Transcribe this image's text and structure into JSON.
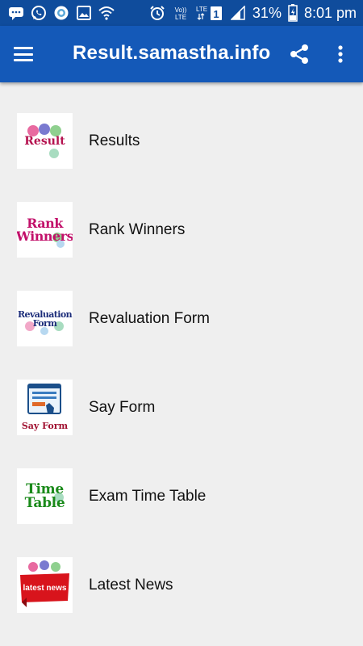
{
  "status_bar": {
    "battery": "31%",
    "time": "8:01 pm",
    "volte_label": "Vo)\nLTE",
    "lte_label": "LTE",
    "sim_number": "1"
  },
  "app_bar": {
    "title": "Result.samastha.info"
  },
  "items": [
    {
      "label": "Results",
      "thumb_text": [
        "Result"
      ],
      "thumb_color": "#b5124f",
      "icon": "results-icon"
    },
    {
      "label": "Rank Winners",
      "thumb_text": [
        "Rank",
        "Winners"
      ],
      "thumb_color": "#c2106a",
      "icon": "rank-winners-icon"
    },
    {
      "label": "Revaluation Form",
      "thumb_text": [
        "Revaluation",
        "Form"
      ],
      "thumb_color": "#1d2e7a",
      "icon": "revaluation-form-icon"
    },
    {
      "label": "Say Form",
      "thumb_text": [
        "Say Form"
      ],
      "thumb_color": "#a01030",
      "icon": "say-form-icon"
    },
    {
      "label": "Exam Time Table",
      "thumb_text": [
        "Time",
        "Table"
      ],
      "thumb_color": "#1a8a1a",
      "icon": "time-table-icon"
    },
    {
      "label": "Latest News",
      "thumb_text": [
        "latest news"
      ],
      "thumb_color": "#d8141c",
      "icon": "latest-news-icon"
    }
  ],
  "colors": {
    "status_bar": "#0f4c9c",
    "app_bar": "#1459b8",
    "background": "#efefef"
  }
}
